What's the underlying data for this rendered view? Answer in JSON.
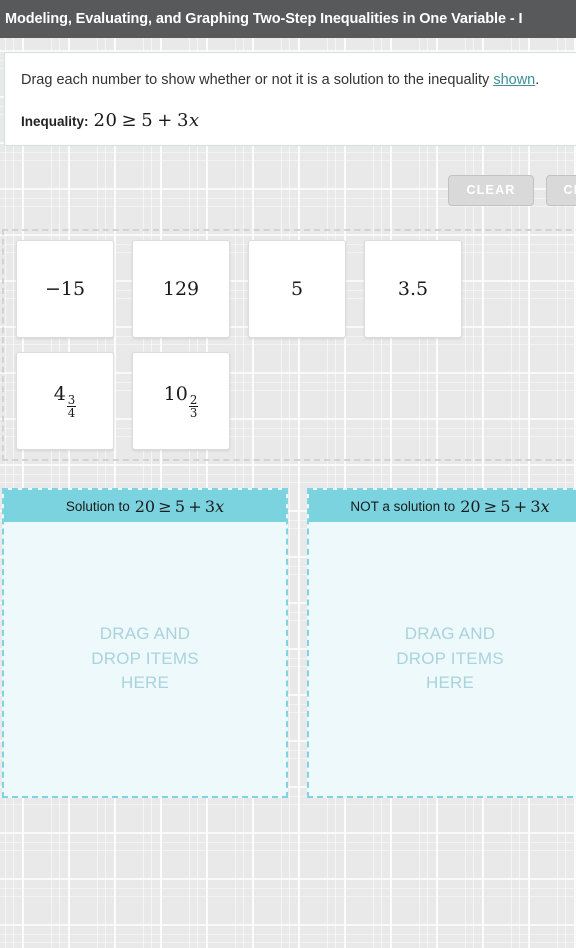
{
  "titlebar": {
    "title": "Modeling, Evaluating, and Graphing Two-Step Inequalities in One Variable - I"
  },
  "prompt": {
    "instruction_before_link": "Drag each number to show whether or not it is a solution to the inequality ",
    "link_text": "shown",
    "instruction_after_link": ".",
    "inequality_label": "Inequality:",
    "inequality_lhs": "20",
    "inequality_relation": "≥",
    "inequality_rhs_constant": "5",
    "inequality_rhs_plus": "+",
    "inequality_rhs_term": "3",
    "inequality_variable": "x",
    "inequality_full": "20 ≥ 5 + 3x"
  },
  "toolbar": {
    "clear_label": "CLEAR",
    "check_label": "CHECK"
  },
  "tray": {
    "rows": [
      [
        {
          "id": "tile-neg15",
          "display": "−15",
          "type": "plain"
        },
        {
          "id": "tile-129",
          "display": "129",
          "type": "plain"
        },
        {
          "id": "tile-5",
          "display": "5",
          "type": "plain"
        },
        {
          "id": "tile-3point5",
          "display": "3.5",
          "type": "plain"
        }
      ],
      [
        {
          "id": "tile-4-3-4",
          "display": "4 3/4",
          "type": "mixed",
          "whole": "4",
          "numerator": "3",
          "denominator": "4"
        },
        {
          "id": "tile-10-2-3",
          "display": "10 2/3",
          "type": "mixed",
          "whole": "10",
          "numerator": "2",
          "denominator": "3"
        }
      ]
    ]
  },
  "dropzones": [
    {
      "id": "dropzone-solution",
      "header_prefix": "Solution to",
      "header_math": "20 ≥ 5 + 3x",
      "placeholder": "DRAG AND\nDROP ITEMS\nHERE"
    },
    {
      "id": "dropzone-not-solution",
      "header_prefix": "NOT a solution to",
      "header_math": "20 ≥ 5 + 3x",
      "placeholder": "DRAG AND\nDROP ITEMS\nHERE"
    }
  ],
  "colors": {
    "titlebar_bg": "#58595b",
    "page_bg": "#e9e9e9",
    "accent_teal": "#7bd3e0",
    "dropzone_bg": "#eef9fb",
    "placeholder_text": "#a9d3dd",
    "link": "#3c8f99",
    "button_bg": "#d9d9d9"
  }
}
